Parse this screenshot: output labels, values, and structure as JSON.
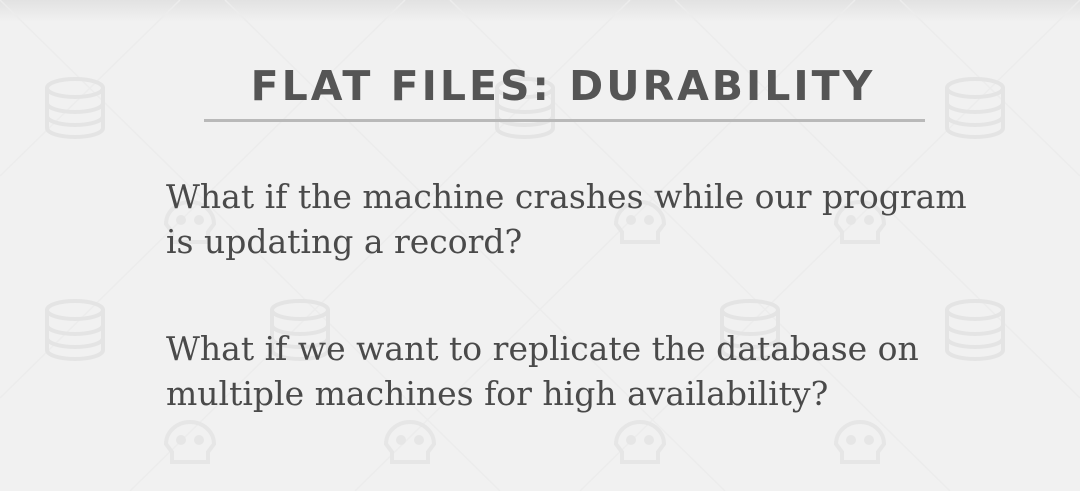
{
  "slide": {
    "title": "FLAT FILES: DURABILITY",
    "paragraphs": [
      "What if the machine crashes while our program is updating a record?",
      "What if we want to replicate the database on multiple machines for high availability?"
    ],
    "colors": {
      "background": "#f1f1f1",
      "title": "#555555",
      "body": "#4a4a4a",
      "rule": "#b9b9b9",
      "pattern": "#e6e6e6"
    },
    "background_icons": [
      "database-icon",
      "skull-icon"
    ]
  }
}
